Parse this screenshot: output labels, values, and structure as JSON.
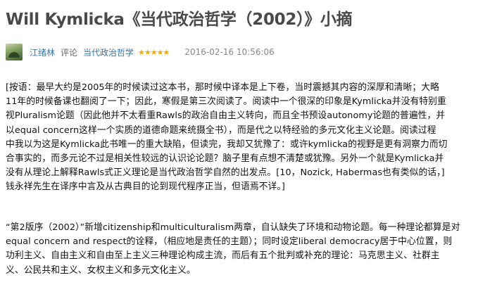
{
  "page": {
    "title": "Will Kymlicka《当代政治哲学（2002）》小摘"
  },
  "meta": {
    "author": "江绪林",
    "action": "评论",
    "work": "当代政治哲学",
    "rating_stars": 5,
    "stars_text": "★★★★★",
    "time": "2016-02-16 10:56:06"
  },
  "body": {
    "para1_lines": [
      "[按语：最早大约是2005年的时候读过这本书，那时候中译本是上下卷，当时震撼其内容的深厚和清晰；大略",
      "11年的时候备课也翻阅了一下；因此，寒假是第三次阅读了。阅读中一个很深的印象是Kymlicka并没有特别重",
      "视Pluralism论题（因此他并不太看重Rawls的政治自由主义转向，而且全书预设autonomy论题的普遍性，并",
      "以equal concern这样一个实质的道德命题来统摄全书），而是代之以特经验的多元文化主义论题。阅读过程",
      "中我以为这是Kymlicka此书唯一的重大缺陷，但读完，我却又犹豫了：或许kymlicka的视野是更有洞察力而切",
      "合事实的，而多元论不过是相关性较远的认识论论题？脑子里有点想不清楚或犹豫。另外一个就是Kymlicka并",
      "没有从理论上解释Rawls式正义理论是当代政治哲学自然的出发点。[10，Nozick, Habermas也有类似的话，]",
      "钱永祥先生在译序中言及从古典目的论到现代程序正当，但语焉不详。]"
    ],
    "para2_lines": [
      "“第2版序（2002）”新增citizenship和multiculturalism两章，自认缺失了环境和动物论题。每一种理论都算是对",
      "equal concern and respect的诠释，（相应地是责任的主题）；同时设定liberal democracy居于中心位置，则",
      "功利主义、自由主义和自由至上主义三种理论构成主流，而后有五个批判或补充的理论：马克思主义、社群主",
      "义、公民共和主义、女权主义和多元文化主义。"
    ]
  },
  "colors": {
    "title": "#494949",
    "link": "#3377aa",
    "stars": "#f8a800",
    "time": "#888888"
  }
}
